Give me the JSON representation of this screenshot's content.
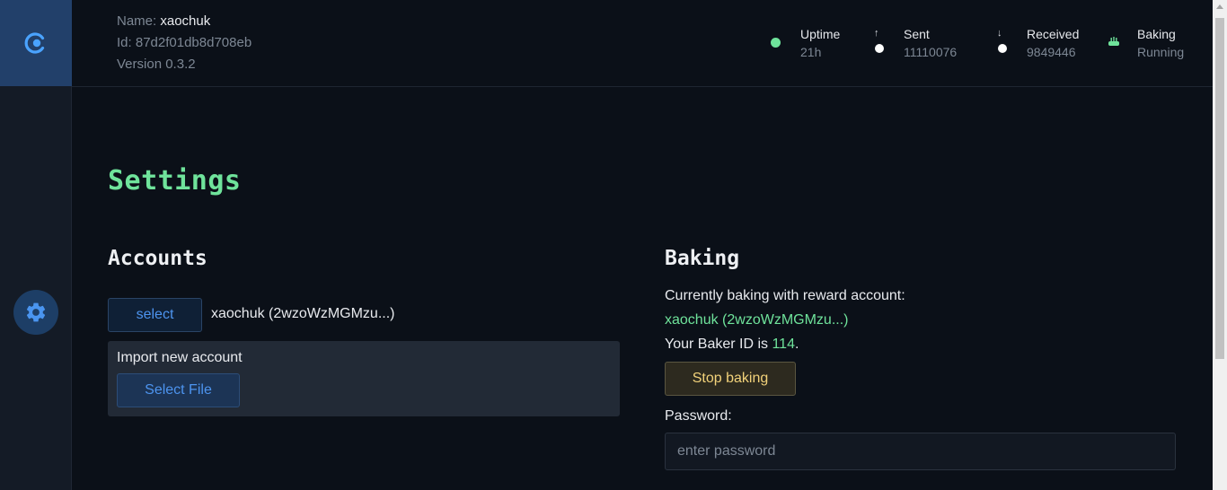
{
  "node": {
    "name_label": "Name:",
    "name_value": "xaochuk",
    "id_label": "Id:",
    "id_value": "87d2f01db8d708eb",
    "version_label": "Version",
    "version_value": "0.3.2"
  },
  "stats": {
    "uptime": {
      "title": "Uptime",
      "value": "21h",
      "dot_color": "#6fe39b"
    },
    "sent": {
      "title": "Sent",
      "value": "11110076",
      "arrow": "↑",
      "dot_color": "#ffffff"
    },
    "received": {
      "title": "Received",
      "value": "9849446",
      "arrow": "↓",
      "dot_color": "#ffffff"
    },
    "baking": {
      "title": "Baking",
      "value": "Running",
      "icon": "cake-icon"
    }
  },
  "page": {
    "title": "Settings"
  },
  "accounts": {
    "title": "Accounts",
    "select_label": "select",
    "current_account": "xaochuk (2wzoWzMGMzu...)",
    "import_title": "Import new account",
    "select_file_label": "Select File"
  },
  "baking": {
    "title": "Baking",
    "currently_label": "Currently baking with reward account:",
    "reward_account": "xaochuk (2wzoWzMGMzu...)",
    "baker_id_prefix": "Your Baker ID is ",
    "baker_id": "114",
    "baker_id_suffix": ".",
    "stop_label": "Stop baking",
    "password_label": "Password:",
    "password_placeholder": "enter password"
  },
  "colors": {
    "accent_green": "#6fe39b",
    "accent_blue": "#4d94ef",
    "warning_yellow": "#f2d27a"
  }
}
